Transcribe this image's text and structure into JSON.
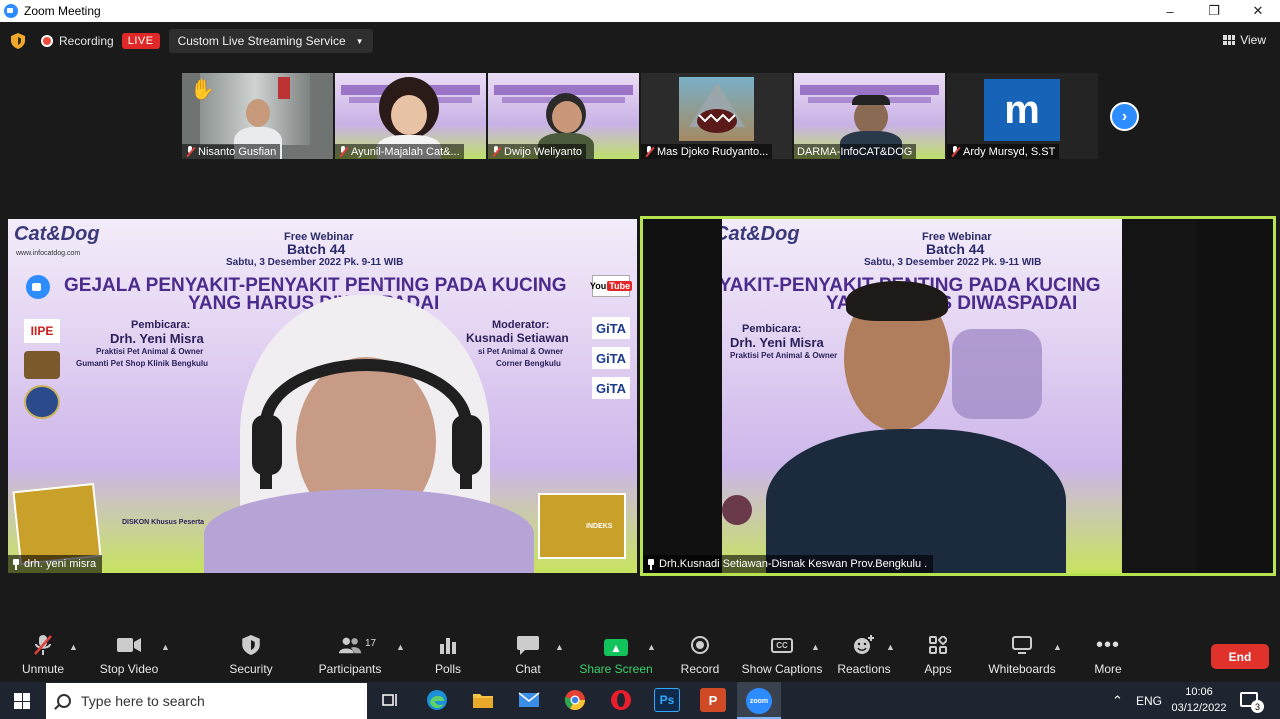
{
  "window": {
    "title": "Zoom Meeting",
    "minimize": "–",
    "maximize": "❐",
    "close": "✕"
  },
  "status_bar": {
    "recording_label": "Recording",
    "live_badge": "LIVE",
    "stream_service": "Custom Live Streaming Service",
    "view_label": "View"
  },
  "thumbnails": [
    {
      "name": "Nisanto Gusfian"
    },
    {
      "name": "Ayunil-Majalah Cat&..."
    },
    {
      "name": "Dwijo Weliyanto"
    },
    {
      "name": "Mas Djoko Rudyanto..."
    },
    {
      "name": "DARMA-InfoCAT&DOG"
    },
    {
      "name": "Ardy Mursyd, S.ST",
      "initial": "m"
    }
  ],
  "banner": {
    "brand": "Cat&Dog",
    "site": "www.infocatdog.com",
    "free_webinar": "Free Webinar",
    "batch": "Batch 44",
    "date": "Sabtu, 3 Desember 2022 Pk. 9-11 WIB",
    "headline_1": "GEJALA PENYAKIT-PENYAKIT PENTING PADA KUCING",
    "headline_2": "YANG HARUS DIWASPADAI",
    "speaker_title": "Pembicara:",
    "speaker_name": "Drh. Yeni Misra",
    "speaker_role": "Praktisi Pet Animal & Owner",
    "speaker_clinic": "Gumanti Pet Shop Klinik Bengkulu",
    "moderator_title": "Moderator:",
    "moderator_name": "Kusnadi Setiawan",
    "moderator_role": "si Pet Animal & Owner",
    "moderator_clinic": "Corner Bengkulu",
    "youtube": "You",
    "youtube_tube": "Tube",
    "gita": "GiTA",
    "ipe": "IIPE",
    "discount": "DISKON Khusus Peserta",
    "indeks": "INDEKS"
  },
  "main_tiles": {
    "left_name": "drh. yeni misra",
    "right_name": "Drh.Kusnadi Setiawan-Disnak Keswan Prov.Bengkulu ."
  },
  "toolbar": {
    "unmute": "Unmute",
    "stop_video": "Stop Video",
    "security": "Security",
    "participants": "Participants",
    "participants_count": "17",
    "polls": "Polls",
    "chat": "Chat",
    "share_screen": "Share Screen",
    "record": "Record",
    "show_captions": "Show Captions",
    "cc": "CC",
    "reactions": "Reactions",
    "apps": "Apps",
    "whiteboards": "Whiteboards",
    "more": "More",
    "end": "End"
  },
  "taskbar": {
    "search_placeholder": "Type here to search",
    "ps": "Ps",
    "ppt": "P",
    "zoom": "zoom",
    "lang": "ENG",
    "time": "10:06",
    "date": "03/12/2022",
    "notifications": "3"
  },
  "colors": {
    "zoom_blue": "#2d8cff",
    "live_red": "#e02828",
    "active_speaker": "#b6e34f",
    "share_green": "#12c25b",
    "end_red": "#e0322b"
  }
}
